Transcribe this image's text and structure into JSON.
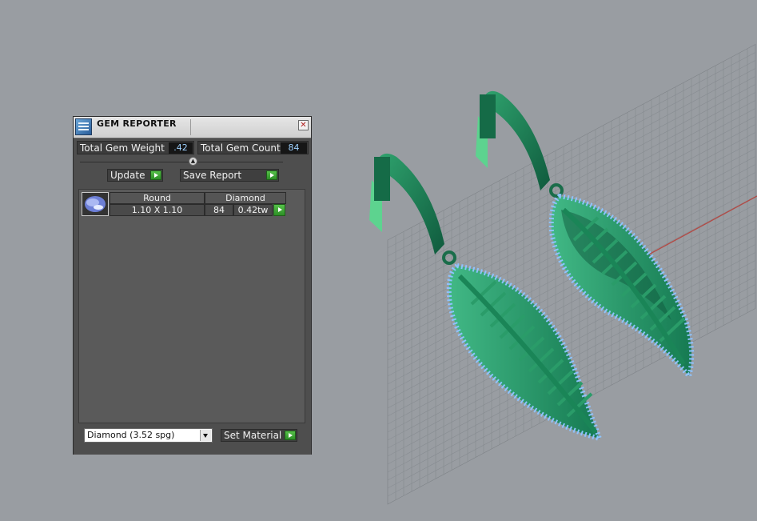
{
  "panel": {
    "title": "GEM REPORTER",
    "close_glyph": "✕",
    "total_gem_weight_label": "Total Gem Weight",
    "total_gem_weight_value": ".42",
    "total_gem_count_label": "Total Gem Count",
    "total_gem_count_value": "84",
    "update_label": "Update",
    "save_report_label": "Save Report",
    "gems": [
      {
        "cut": "Round",
        "material": "Diamond",
        "size": "1.10 X 1.10",
        "count": "84",
        "weight": "0.42tw"
      }
    ],
    "material_select": "Diamond    (3.52 spg)",
    "set_material_label": "Set Material"
  },
  "colors": {
    "background": "#999da2",
    "metal_dark": "#1e7a57",
    "metal_light": "#4fcf83",
    "gem_blue": "#8ec4ff",
    "grid": "#8a8e93",
    "accent_green": "#3aa62f"
  },
  "icons": [
    "app-icon",
    "close-icon",
    "play-icon",
    "gem-thumbnail",
    "chevron-down-icon"
  ]
}
